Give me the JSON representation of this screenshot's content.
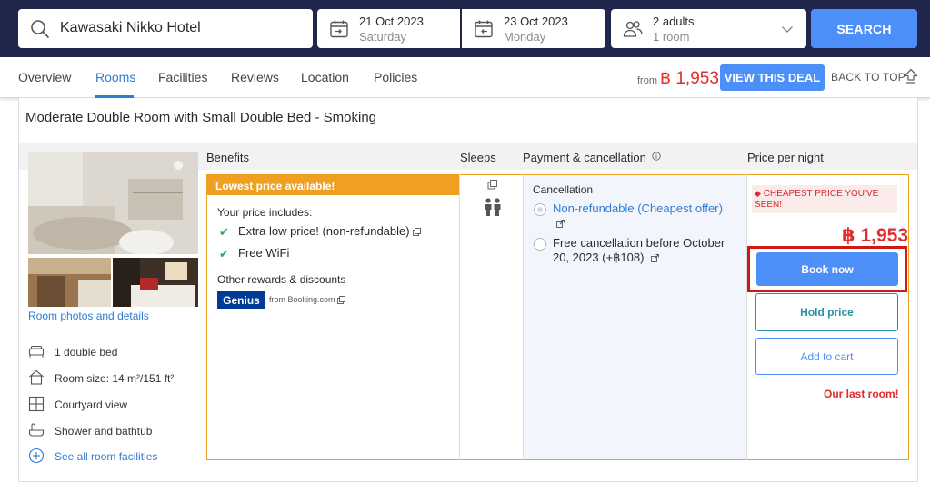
{
  "search": {
    "destination": "Kawasaki Nikko Hotel",
    "checkin_date": "21 Oct 2023",
    "checkin_day": "Saturday",
    "checkout_date": "23 Oct 2023",
    "checkout_day": "Monday",
    "guests": "2 adults",
    "rooms": "1 room",
    "search_label": "SEARCH"
  },
  "nav": {
    "tabs": [
      {
        "label": "Overview"
      },
      {
        "label": "Rooms"
      },
      {
        "label": "Facilities"
      },
      {
        "label": "Reviews"
      },
      {
        "label": "Location"
      },
      {
        "label": "Policies"
      }
    ],
    "active_tab": "Rooms",
    "from_label": "from",
    "from_price": "฿ 1,953",
    "deal_label": "VIEW THIS DEAL",
    "back_to_top": "BACK TO TOP"
  },
  "room": {
    "title": "Moderate Double Room with Small Double Bed - Smoking",
    "photos_link": "Room photos and details",
    "features": [
      {
        "icon": "bed-icon",
        "text": "1 double bed"
      },
      {
        "icon": "house-icon",
        "text": "Room size: 14 m²/151 ft²"
      },
      {
        "icon": "window-icon",
        "text": "Courtyard view"
      },
      {
        "icon": "bathtub-icon",
        "text": "Shower and bathtub"
      }
    ],
    "see_all": "See all room facilities"
  },
  "headers": {
    "benefits": "Benefits",
    "sleeps": "Sleeps",
    "payment": "Payment & cancellation",
    "price": "Price per night"
  },
  "offer": {
    "badge": "Lowest price available!",
    "your_price_includes": "Your price includes:",
    "benefits": [
      "Extra low price! (non-refundable)",
      "Free WiFi"
    ],
    "other_rewards": "Other rewards & discounts",
    "genius": "Genius",
    "from_booking": "from Booking.com",
    "cancellation_heading": "Cancellation",
    "options": [
      {
        "label": "Non-refundable (Cheapest offer)",
        "selected": true
      },
      {
        "label": "Free cancellation before October 20, 2023 (+฿108)",
        "selected": false
      }
    ],
    "cheapest_tag": "CHEAPEST PRICE YOU'VE SEEN!",
    "price": "฿ 1,953",
    "book_now": "Book now",
    "hold_price": "Hold price",
    "add_to_cart": "Add to cart",
    "last_room": "Our last room!"
  },
  "colors": {
    "header_bg": "#20274d",
    "accent_blue": "#4d8ff8",
    "price_red": "#e12d2d",
    "badge_orange": "#f0a020",
    "highlight_red": "#d21717"
  }
}
